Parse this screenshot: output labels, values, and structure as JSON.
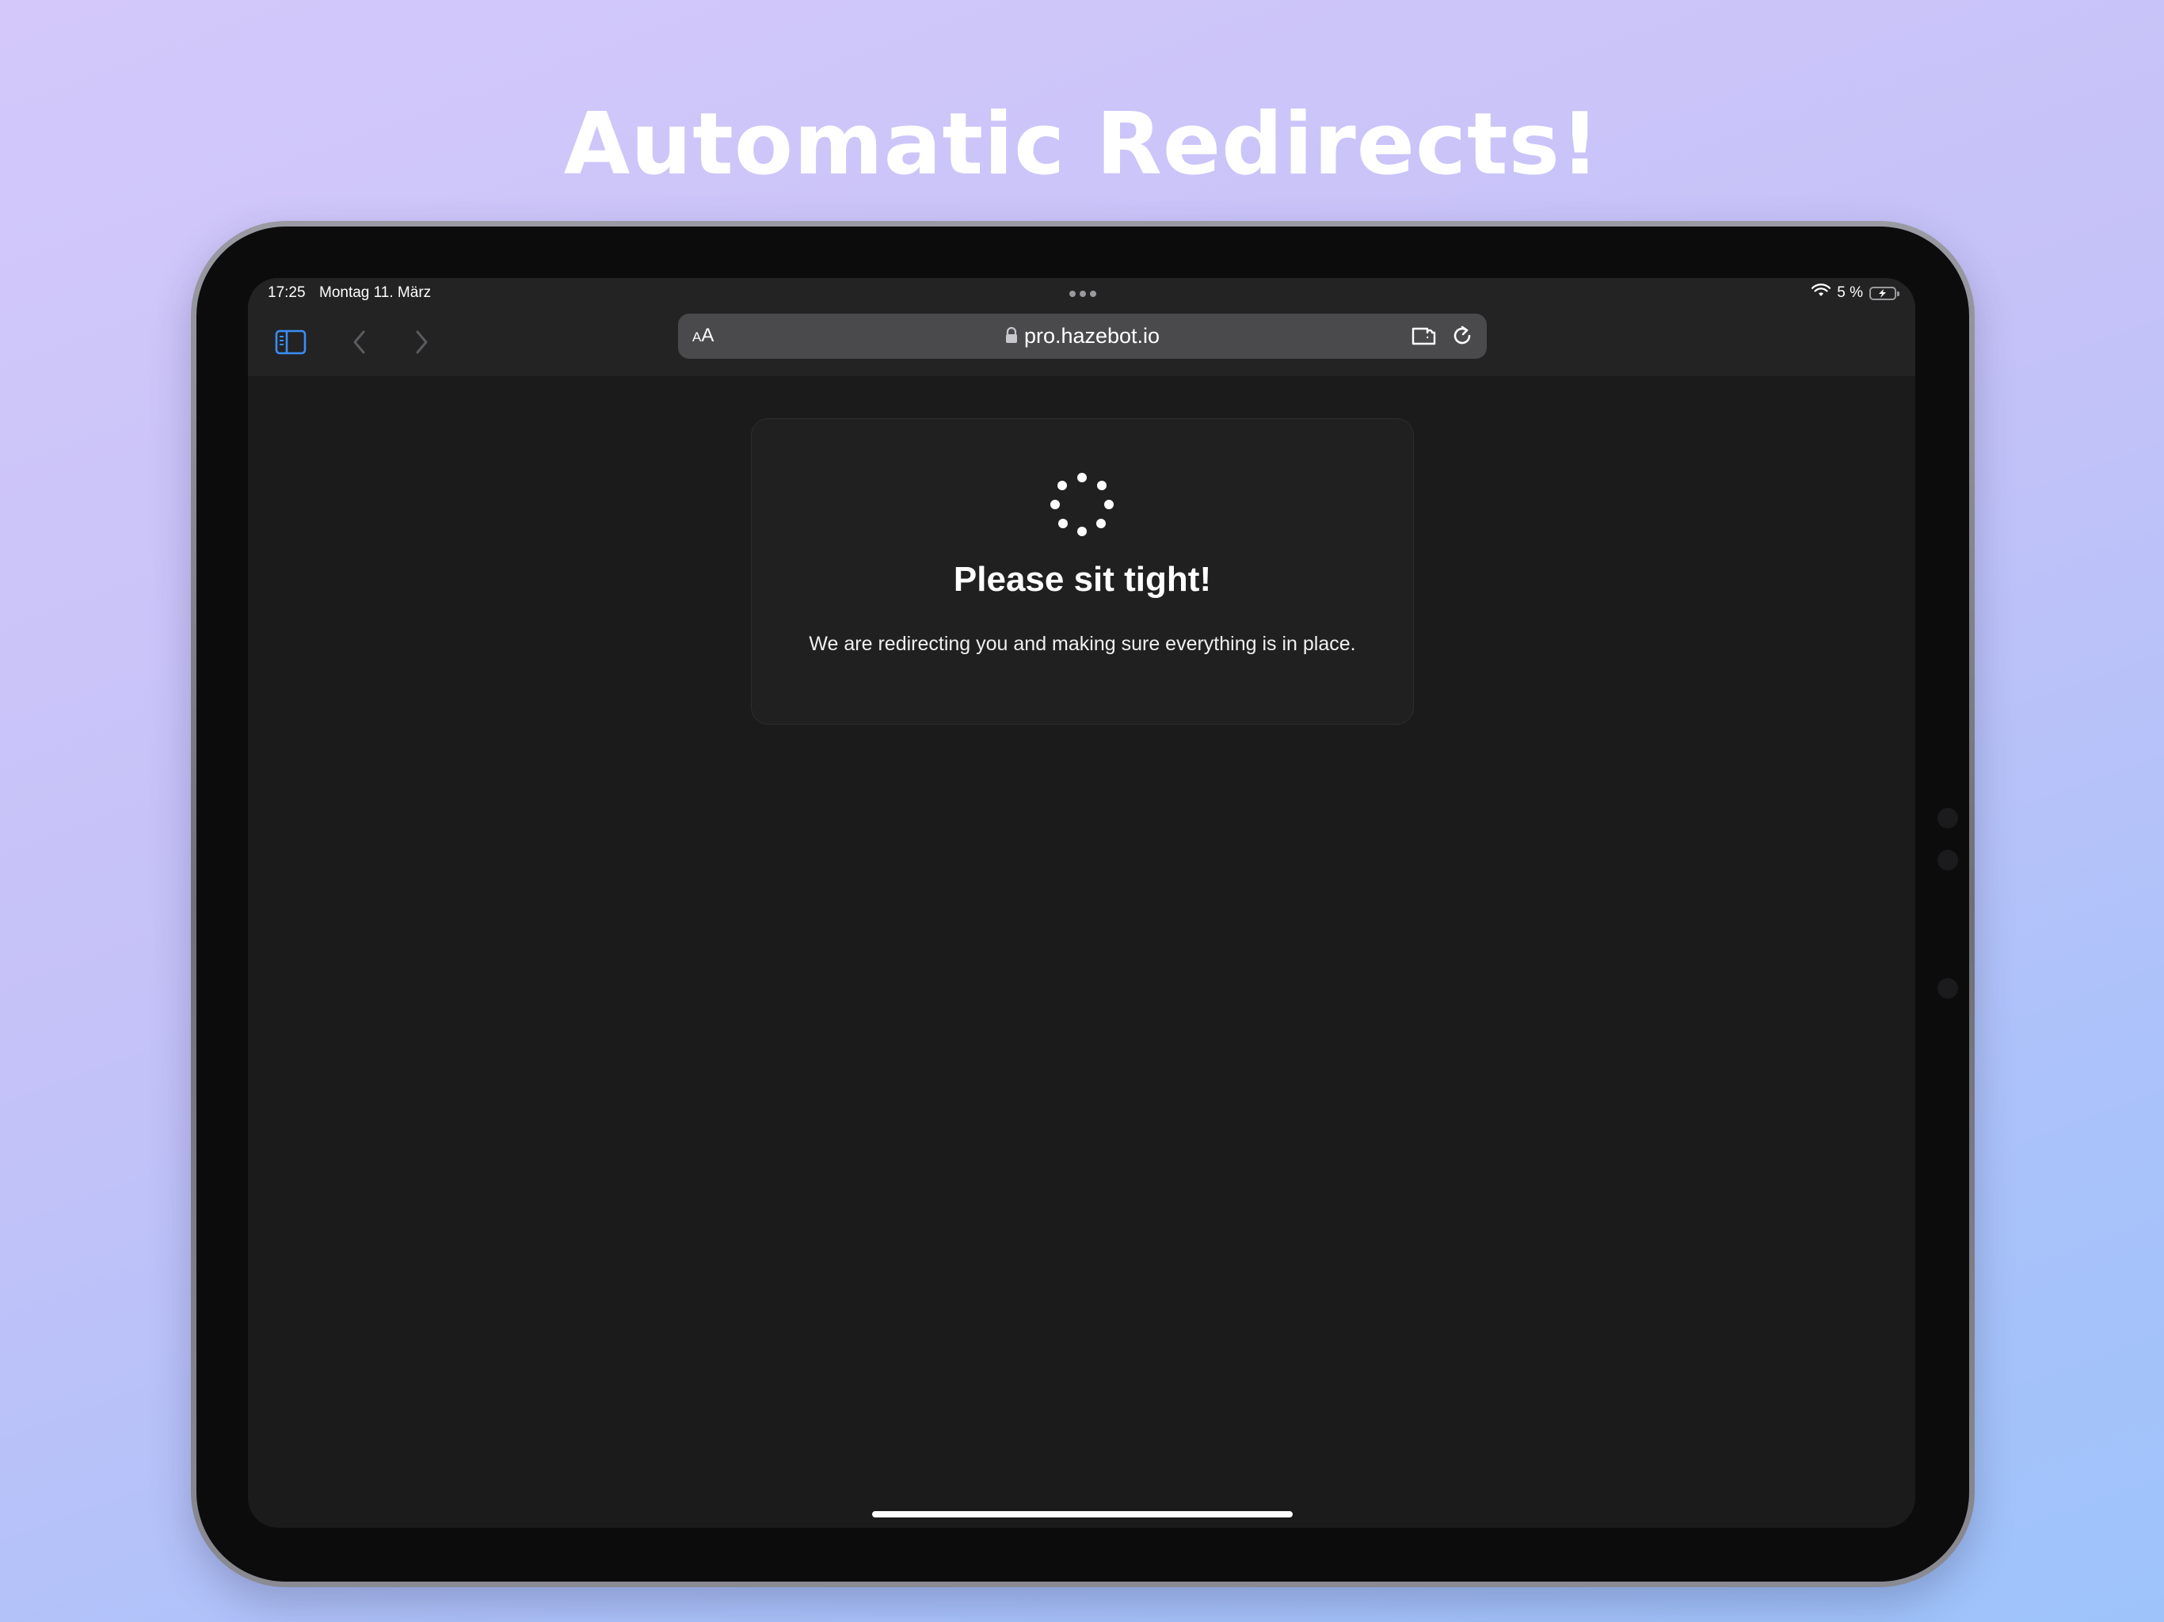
{
  "headline": "Automatic Redirects!",
  "status_bar": {
    "time": "17:25",
    "date": "Montag 11. März",
    "battery": "5 %",
    "icons": [
      "wifi-icon",
      "battery-charging-icon"
    ]
  },
  "toolbar": {
    "icons": [
      "sidebar-icon",
      "back-icon",
      "forward-icon",
      "share-icon",
      "plus-icon",
      "tabs-icon"
    ],
    "accent_color": "#3a8ef5"
  },
  "address_bar": {
    "reader_label_small": "A",
    "reader_label_large": "A",
    "url": "pro.hazebot.io",
    "icons": [
      "lock-icon",
      "extension-icon",
      "reload-icon"
    ]
  },
  "card": {
    "title": "Please sit tight!",
    "message": "We are redirecting you and making sure everything is in place.",
    "icons": [
      "loading-spinner-icon"
    ]
  }
}
